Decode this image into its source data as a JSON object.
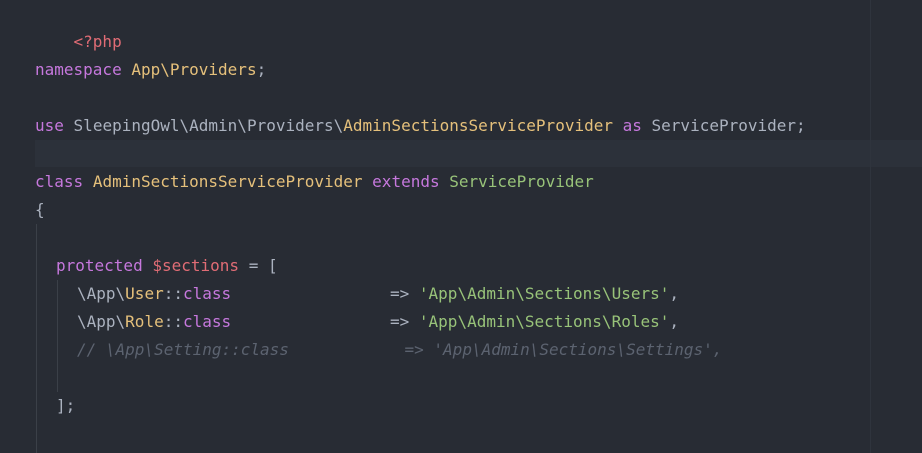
{
  "colors": {
    "background": "#282c34",
    "keyword": "#c678dd",
    "class_name": "#e5c07b",
    "plain": "#abb2bf",
    "variable": "#e06c75",
    "string": "#98c379",
    "comment": "#5c6370"
  },
  "code": {
    "php_open": "<?php",
    "ns_kw": "namespace",
    "ns_name": "App\\Providers",
    "semicolon": ";",
    "use_kw": "use",
    "use_path": "SleepingOwl\\Admin\\Providers\\",
    "use_class": "AdminSectionsServiceProvider",
    "as_kw": "as",
    "alias": "ServiceProvider",
    "class_kw": "class",
    "class_name": "AdminSectionsServiceProvider",
    "extends_kw": "extends",
    "parent_class": "ServiceProvider",
    "brace_open": "{",
    "protected_kw": "protected",
    "prop_var": "$sections",
    "assign": "= [",
    "row1_ns": "\\App\\",
    "row1_cls": "User",
    "row1_sep": "::",
    "row1_kw": "class",
    "row1_arrow": "=>",
    "row1_str": "'App\\Admin\\Sections\\Users'",
    "row1_comma": ",",
    "row2_ns": "\\App\\",
    "row2_cls": "Role",
    "row2_sep": "::",
    "row2_kw": "class",
    "row2_arrow": "=>",
    "row2_str": "'App\\Admin\\Sections\\Roles'",
    "row2_comma": ",",
    "comment_line": "// \\App\\Setting::class            => 'App\\Admin\\Sections\\Settings',",
    "array_close": "];"
  }
}
